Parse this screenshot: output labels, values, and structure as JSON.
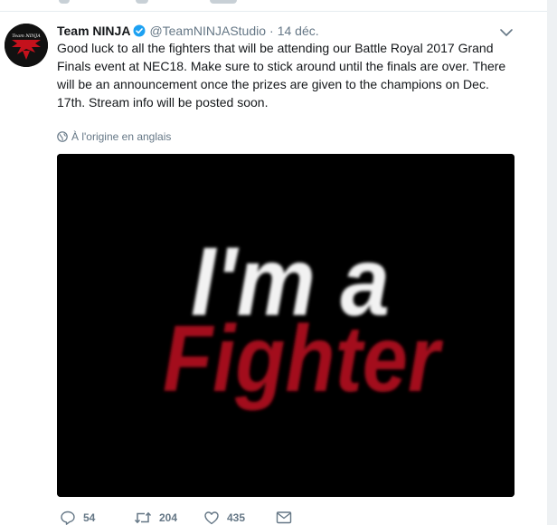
{
  "tweet": {
    "author_name": "Team NINJA",
    "avatar_logo_text": "Team NINJA",
    "handle": "@TeamNINJAStudio",
    "separator": "·",
    "date": "14 déc.",
    "text": "Good luck to all the fighters that will be attending our Battle Royal 2017 Grand Finals event at NEC18. Make sure to stick around until the finals are over. There will be an announcement once the prizes are given to the champions on Dec. 17th. Stream info will be posted soon.",
    "translation_note": "À l'origine en anglais",
    "media": {
      "line1": "I'm a",
      "line2": "Fighter"
    },
    "actions": {
      "replies": "54",
      "retweets": "204",
      "likes": "435"
    }
  },
  "icons": {
    "verified": "verified-badge-icon",
    "caret": "chevron-down-icon",
    "globe": "globe-icon",
    "reply": "reply-icon",
    "retweet": "retweet-icon",
    "like": "heart-icon",
    "message": "envelope-icon"
  },
  "colors": {
    "text_primary": "#14171a",
    "text_secondary": "#657786",
    "verified_blue": "#1da1f2",
    "media_background": "#000000",
    "fighter_red": "#a3111c",
    "page_background": "#e6ecf0"
  }
}
